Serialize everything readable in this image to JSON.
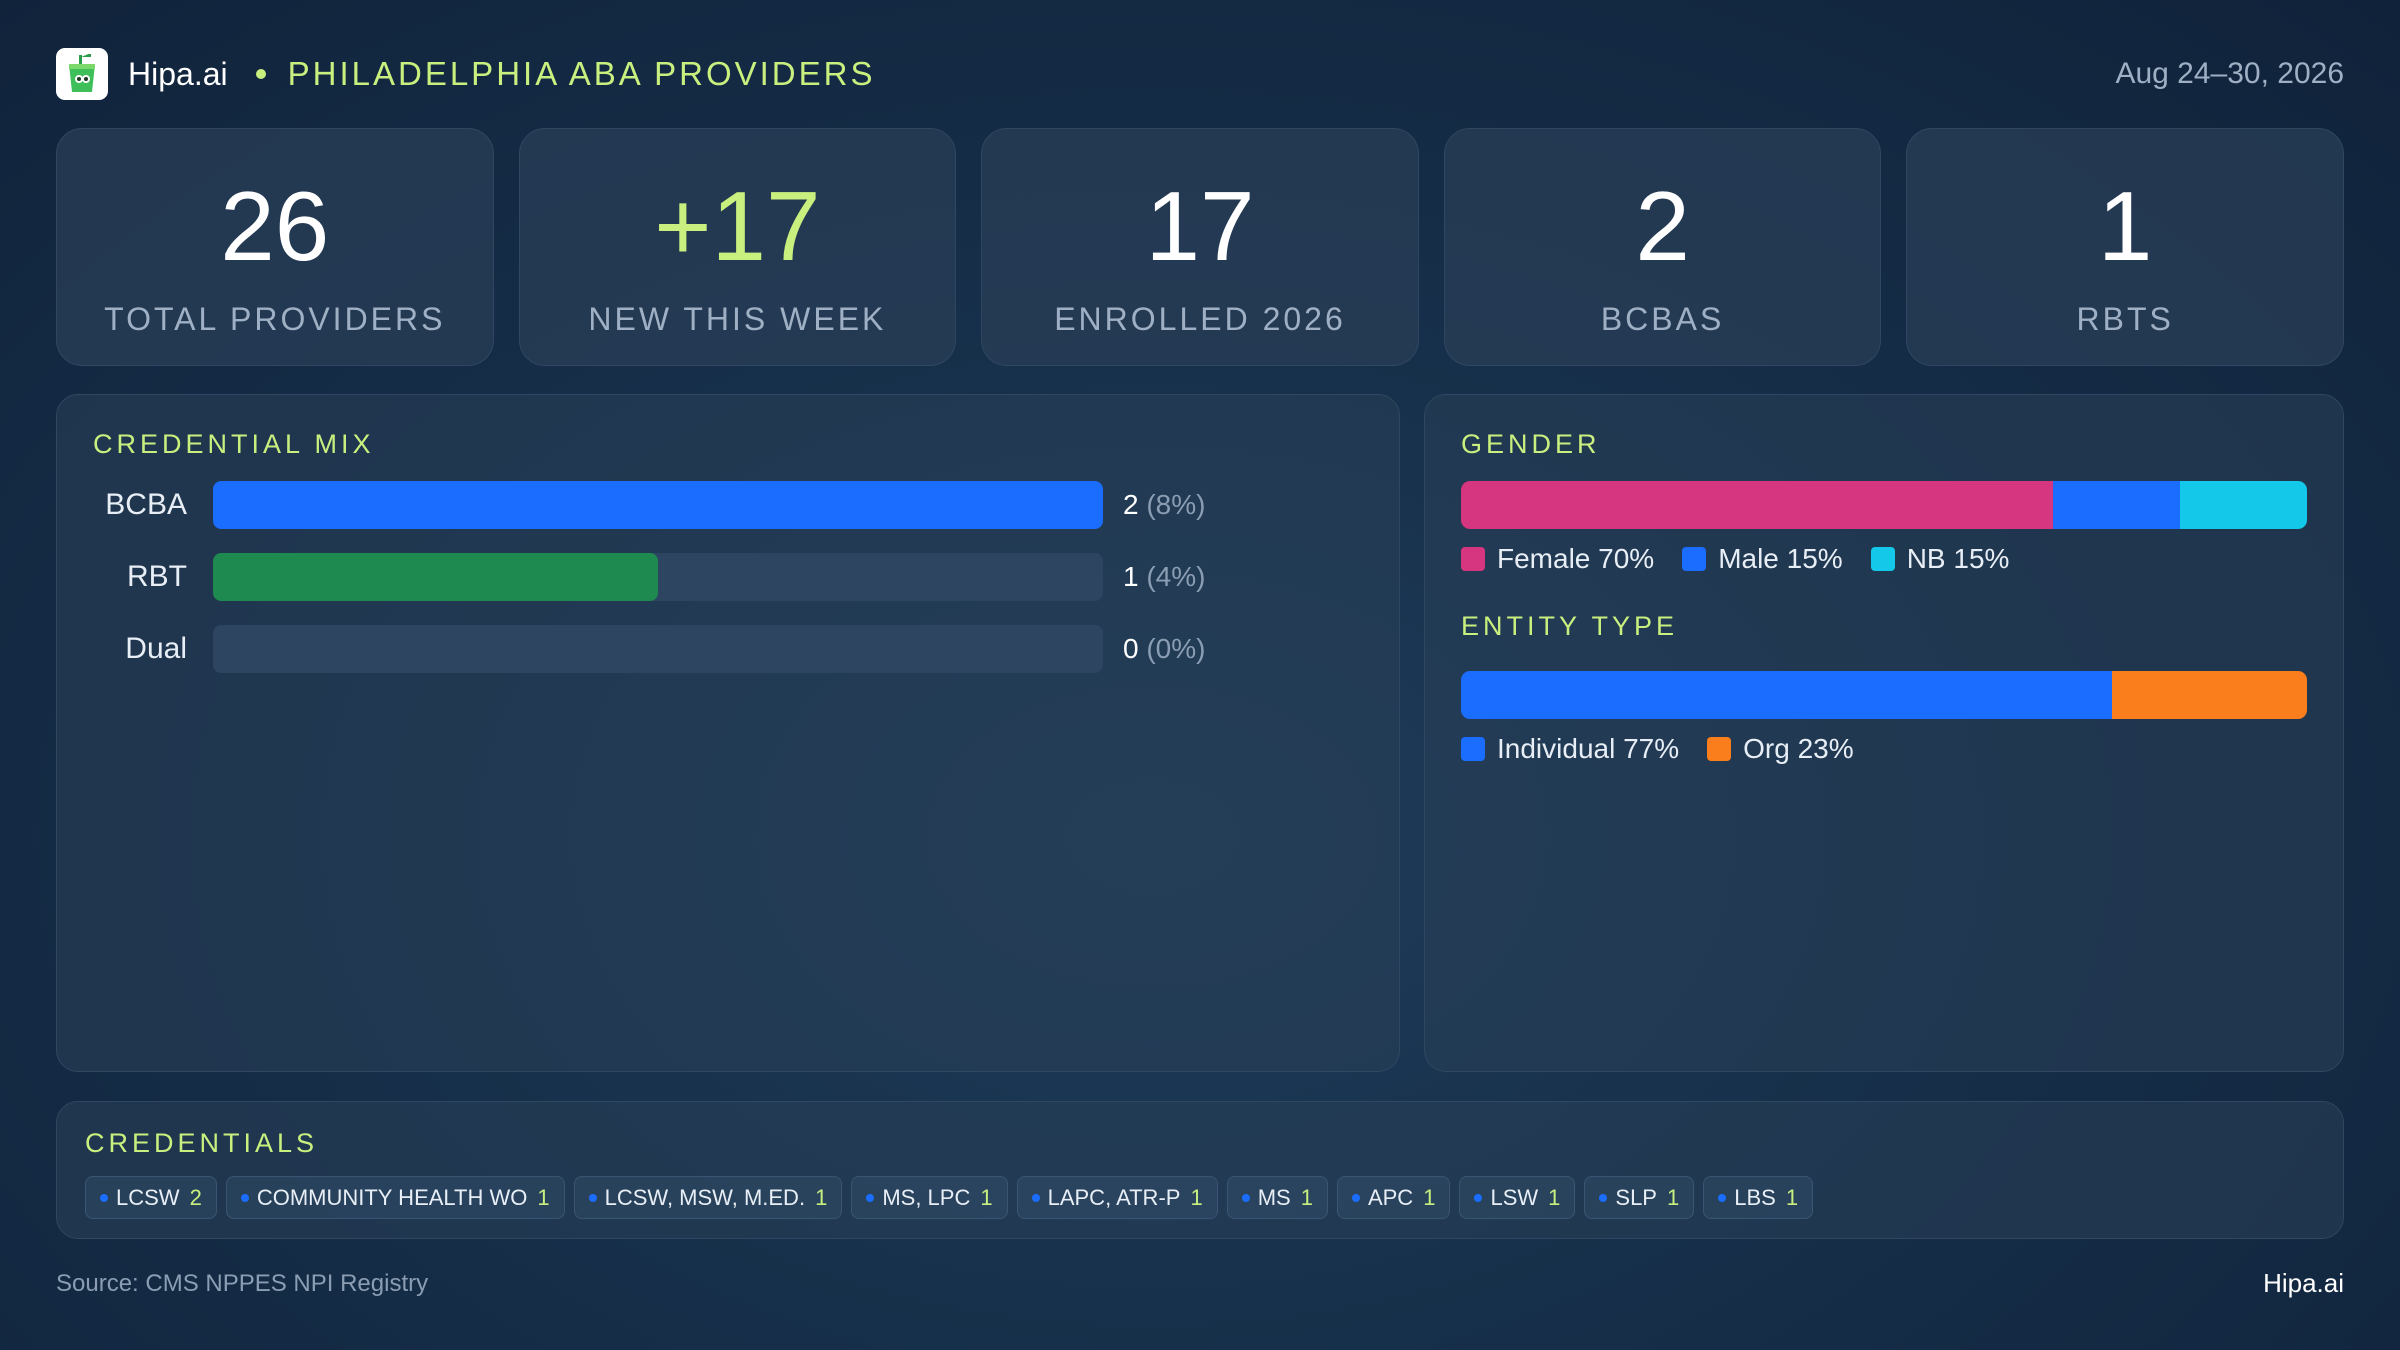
{
  "header": {
    "brand": "Hipa.ai",
    "subtitle": "PHILADELPHIA ABA PROVIDERS",
    "date_range": "Aug 24–30, 2026"
  },
  "kpis": [
    {
      "value": "26",
      "label": "TOTAL PROVIDERS"
    },
    {
      "value": "+17",
      "label": "NEW THIS WEEK"
    },
    {
      "value": "17",
      "label": "ENROLLED 2026"
    },
    {
      "value": "2",
      "label": "BCBAS"
    },
    {
      "value": "1",
      "label": "RBTS"
    }
  ],
  "credential_mix": {
    "title": "CREDENTIAL MIX",
    "rows": [
      {
        "label": "BCBA",
        "count": "2",
        "pct": "(8%)",
        "fill_fraction": 1.0,
        "color": "#1a6dff"
      },
      {
        "label": "RBT",
        "count": "1",
        "pct": "(4%)",
        "fill_fraction": 0.5,
        "color": "#1e8a4f"
      },
      {
        "label": "Dual",
        "count": "0",
        "pct": "(0%)",
        "fill_fraction": 0.0,
        "color": "#1e8a4f"
      }
    ]
  },
  "gender": {
    "title": "GENDER",
    "segments": [
      {
        "label": "Female 70%",
        "share": 70,
        "color": "#d6357f"
      },
      {
        "label": "Male 15%",
        "share": 15,
        "color": "#1a6dff"
      },
      {
        "label": "NB 15%",
        "share": 15,
        "color": "#14c8ea"
      }
    ]
  },
  "entity_type": {
    "title": "ENTITY TYPE",
    "segments": [
      {
        "label": "Individual 77%",
        "share": 77,
        "color": "#1a6dff"
      },
      {
        "label": "Org 23%",
        "share": 23,
        "color": "#fb7e1c"
      }
    ]
  },
  "credentials": {
    "title": "CREDENTIALS",
    "chips": [
      {
        "label": "LCSW",
        "count": "2"
      },
      {
        "label": "COMMUNITY HEALTH WO",
        "count": "1"
      },
      {
        "label": "LCSW, MSW, M.ED.",
        "count": "1"
      },
      {
        "label": "MS, LPC",
        "count": "1"
      },
      {
        "label": "LAPC, ATR-P",
        "count": "1"
      },
      {
        "label": "MS",
        "count": "1"
      },
      {
        "label": "APC",
        "count": "1"
      },
      {
        "label": "LSW",
        "count": "1"
      },
      {
        "label": "SLP",
        "count": "1"
      },
      {
        "label": "LBS",
        "count": "1"
      }
    ]
  },
  "footer": {
    "source": "Source: CMS NPPES NPI Registry",
    "brand": "Hipa.ai"
  },
  "colors": {
    "accent": "#c9f07f",
    "background": "#17304b"
  }
}
